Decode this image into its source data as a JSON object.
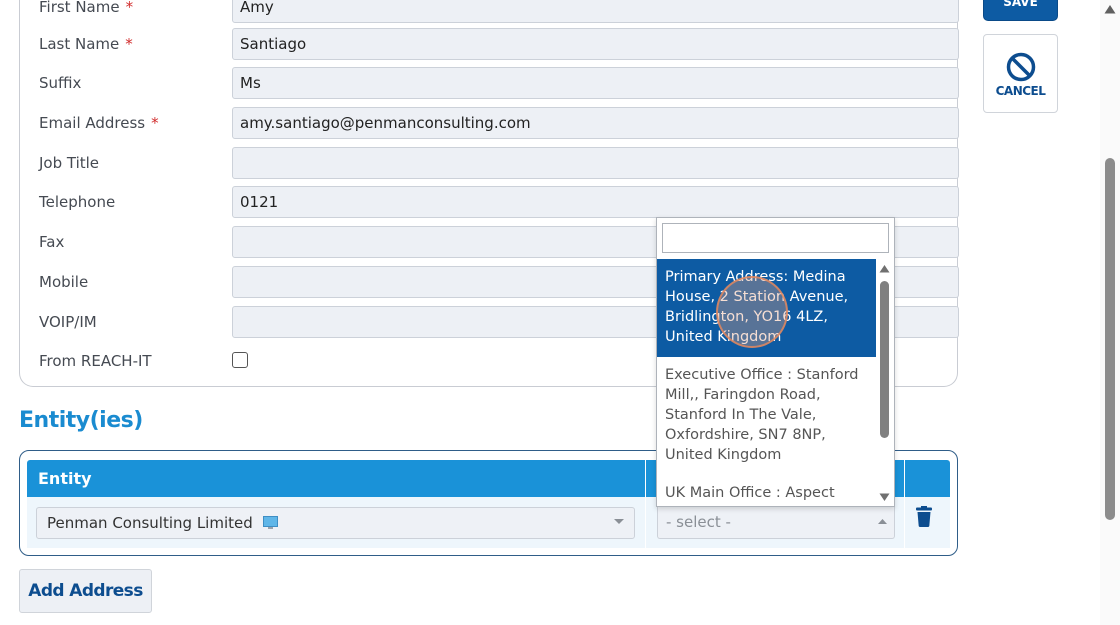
{
  "form": {
    "fields": [
      {
        "label": "First Name",
        "required": true,
        "value": "Amy"
      },
      {
        "label": "Last Name",
        "required": true,
        "value": "Santiago"
      },
      {
        "label": "Suffix",
        "required": false,
        "value": "Ms"
      },
      {
        "label": "Email Address",
        "required": true,
        "value": "amy.santiago@penmanconsulting.com"
      },
      {
        "label": "Job Title",
        "required": false,
        "value": ""
      },
      {
        "label": "Telephone",
        "required": false,
        "value": "0121"
      },
      {
        "label": "Fax",
        "required": false,
        "value": ""
      },
      {
        "label": "Mobile",
        "required": false,
        "value": ""
      },
      {
        "label": "VOIP/IM",
        "required": false,
        "value": ""
      }
    ],
    "required_marker": "*",
    "from_reachit": {
      "label": "From REACH-IT",
      "checked": false
    }
  },
  "actions": {
    "save_label": "SAVE",
    "cancel_label": "CANCEL"
  },
  "entities": {
    "title": "Entity(ies)",
    "header": "Entity",
    "entity_value": "Penman Consulting Limited",
    "address_placeholder": "- select -"
  },
  "address_dropdown": {
    "search_value": "",
    "options": [
      "Primary Address: Medina House, 2 Station Avenue, Bridlington, YO16 4LZ, United Kingdom",
      "Executive Office : Stanford Mill,, Faringdon Road, Stanford In The Vale, Oxfordshire, SN7 8NP, United Kingdom",
      "UK Main Office : Aspect House, Wayland Avenue"
    ],
    "highlighted_index": 0
  },
  "add_address_label": "Add Address",
  "colors": {
    "accent": "#1a92d8",
    "primary_button": "#0d5ba3",
    "required": "#d12c2c",
    "highlight": "#0d5ba3"
  },
  "icons": {
    "cancel": "ban-icon",
    "entity_type": "monitor-icon",
    "delete": "trash-icon"
  }
}
